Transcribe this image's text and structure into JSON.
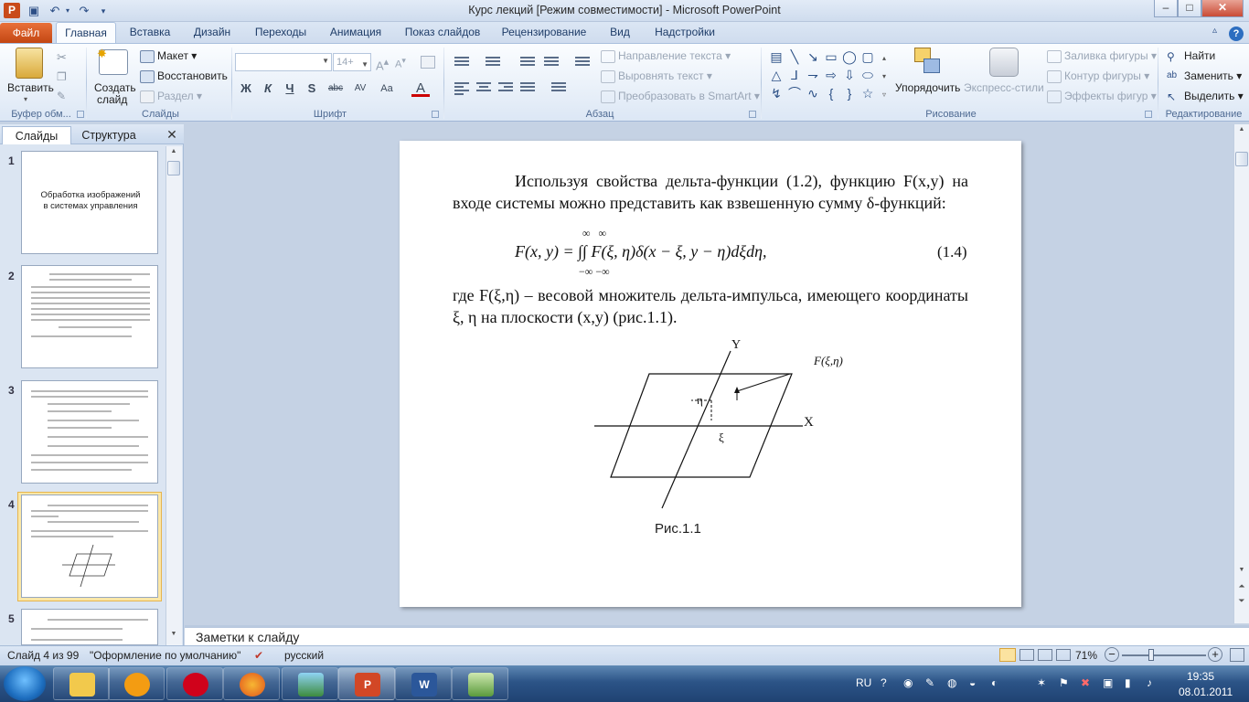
{
  "window": {
    "title": "Курс лекций [Режим совместимости]  -  Microsoft PowerPoint",
    "app_icon_letter": "P",
    "controls": {
      "minimize": "–",
      "maximize": "□",
      "close": "✕"
    }
  },
  "quick_access": [
    "save-icon",
    "undo-icon",
    "redo-icon",
    "customize-icon"
  ],
  "tabs": {
    "file": "Файл",
    "items": [
      "Главная",
      "Вставка",
      "Дизайн",
      "Переходы",
      "Анимация",
      "Показ слайдов",
      "Рецензирование",
      "Вид",
      "Надстройки"
    ],
    "active": "Главная"
  },
  "ribbon": {
    "clipboard": {
      "label": "Буфер обм...",
      "paste": "Вставить"
    },
    "slides": {
      "label": "Слайды",
      "new_slide_line1": "Создать",
      "new_slide_line2": "слайд",
      "layout": "Макет",
      "reset": "Восстановить",
      "section": "Раздел"
    },
    "font": {
      "label": "Шрифт",
      "font_name": "",
      "font_size": "14+",
      "bold": "Ж",
      "italic": "К",
      "underline": "Ч",
      "shadow": "S",
      "strike": "abc",
      "spacing": "AV",
      "case": "Aa",
      "color": "A"
    },
    "paragraph": {
      "label": "Абзац",
      "text_direction": "Направление текста",
      "align_text": "Выровнять текст",
      "smartart": "Преобразовать в SmartArt"
    },
    "drawing": {
      "label": "Рисование",
      "arrange": "Упорядочить",
      "quick_styles": "Экспресс-стили",
      "fill": "Заливка фигуры",
      "outline": "Контур фигуры",
      "effects": "Эффекты фигур"
    },
    "editing": {
      "label": "Редактирование",
      "find": "Найти",
      "replace": "Заменить",
      "select": "Выделить"
    }
  },
  "left_pane": {
    "tabs": [
      "Слайды",
      "Структура"
    ],
    "close": "✕",
    "slides": [
      {
        "num": "1",
        "title": "Обработка изображений в системах управления"
      },
      {
        "num": "2"
      },
      {
        "num": "3"
      },
      {
        "num": "4",
        "selected": true
      },
      {
        "num": "5"
      }
    ]
  },
  "slide": {
    "para1": "Используя свойства дельта-функции (1.2), функцию F(x,y) на входе системы можно представить как взвешенную сумму δ-функций:",
    "formula": "F(x, y) = ∫∫ F(ξ, η)δ(x − ξ, y − η)dξdη,",
    "limits_upper": "∞  ∞",
    "limits_lower": "−∞ −∞",
    "eq_number": "(1.4)",
    "para2": "где F(ξ,η) – весовой множитель дельта-импульса, имеющего координаты ξ, η на плоскости (x,y) (рис.1.1).",
    "figure": {
      "axis_y": "Y",
      "axis_x": "X",
      "point_label": "F(ξ,η)",
      "eta": "η",
      "xi": "ξ"
    },
    "caption": "Рис.1.1"
  },
  "notes": {
    "placeholder": "Заметки к слайду"
  },
  "status": {
    "slide_info": "Слайд 4 из 99",
    "theme": "\"Оформление по умолчанию\"",
    "language": "русский",
    "zoom": "71%",
    "zoom_level": 0.35
  },
  "taskbar": {
    "apps": [
      "explorer",
      "media-player",
      "opera",
      "firefox",
      "picture-viewer",
      "powerpoint",
      "word",
      "network-tool"
    ],
    "lang": "RU",
    "time": "19:35",
    "date": "08.01.2011"
  },
  "colors": {
    "accent": "#2b579a",
    "file_tab": "#d35a22",
    "selected_thumb": "#f6c557"
  }
}
